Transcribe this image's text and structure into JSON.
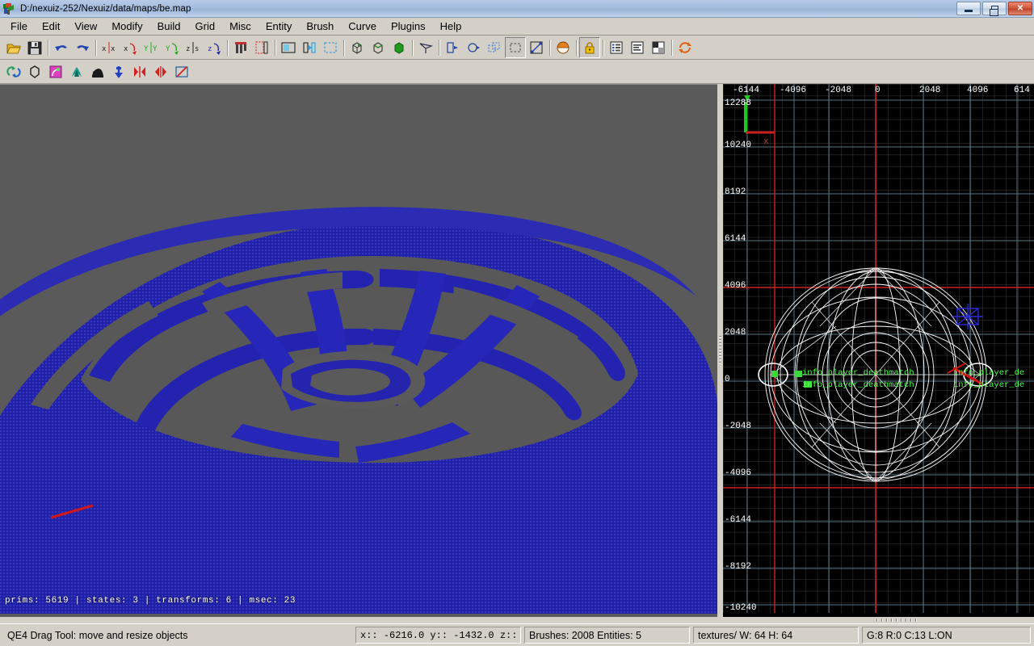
{
  "window": {
    "title": "D:/nexuiz-252/Nexuiz/data/maps/be.map",
    "app_icon": "radiant-app-icon",
    "minimize_label": "",
    "maximize_label": "",
    "close_label": "✕"
  },
  "menubar": {
    "items": [
      {
        "label": "File",
        "accel": "F"
      },
      {
        "label": "Edit",
        "accel": "E"
      },
      {
        "label": "View",
        "accel": "w"
      },
      {
        "label": "Modify",
        "accel": "o"
      },
      {
        "label": "Build",
        "accel": "B"
      },
      {
        "label": "Grid",
        "accel": "G"
      },
      {
        "label": "Misc",
        "accel": "M"
      },
      {
        "label": "Entity",
        "accel": "n"
      },
      {
        "label": "Brush",
        "accel": "r"
      },
      {
        "label": "Curve",
        "accel": "C"
      },
      {
        "label": "Plugins",
        "accel": "P"
      },
      {
        "label": "Help",
        "accel": "H"
      }
    ]
  },
  "toolbar_main": {
    "items": [
      {
        "name": "open-file-button",
        "icon": "folder-open-icon",
        "type": "button"
      },
      {
        "name": "save-file-button",
        "icon": "floppy-save-icon",
        "type": "button"
      },
      {
        "name": "separator-1",
        "icon": "separator",
        "type": "separator"
      },
      {
        "name": "undo-button",
        "icon": "undo-arrow-icon",
        "type": "button"
      },
      {
        "name": "redo-button",
        "icon": "redo-arrow-icon",
        "type": "button"
      },
      {
        "name": "separator-2",
        "icon": "separator",
        "type": "separator"
      },
      {
        "name": "flip-x-button",
        "icon": "flip-x-icon",
        "type": "button"
      },
      {
        "name": "rotate-x-button",
        "icon": "rotate-x-icon",
        "type": "button"
      },
      {
        "name": "flip-y-button",
        "icon": "flip-y-icon",
        "type": "button"
      },
      {
        "name": "rotate-y-button",
        "icon": "rotate-y-icon",
        "type": "button"
      },
      {
        "name": "flip-z-button",
        "icon": "flip-z-icon",
        "type": "button"
      },
      {
        "name": "rotate-z-button",
        "icon": "rotate-z-icon",
        "type": "button"
      },
      {
        "name": "separator-3",
        "icon": "separator",
        "type": "separator"
      },
      {
        "name": "clipper-button",
        "icon": "clipper-icon",
        "type": "button"
      },
      {
        "name": "connect-entities-button",
        "icon": "connect-entities-icon",
        "type": "button"
      },
      {
        "name": "separator-4",
        "icon": "separator",
        "type": "separator"
      },
      {
        "name": "show-entities-button",
        "icon": "show-entities-icon",
        "type": "button"
      },
      {
        "name": "change-view-button",
        "icon": "change-view-icon",
        "type": "button"
      },
      {
        "name": "select-inside-button",
        "icon": "select-inside-icon",
        "type": "button"
      },
      {
        "name": "separator-5",
        "icon": "separator",
        "type": "separator"
      },
      {
        "name": "cubic-clip-button",
        "icon": "cube-wire-icon",
        "type": "button"
      },
      {
        "name": "cube-outline-button",
        "icon": "cube-outline-icon",
        "type": "button"
      },
      {
        "name": "cube-filled-button",
        "icon": "cube-filled-icon",
        "type": "button"
      },
      {
        "name": "separator-6",
        "icon": "separator",
        "type": "separator"
      },
      {
        "name": "camera-button",
        "icon": "camera-frustum-icon",
        "type": "button"
      },
      {
        "name": "separator-7",
        "icon": "separator",
        "type": "separator"
      },
      {
        "name": "select-touching-button",
        "icon": "select-touching-icon",
        "type": "button"
      },
      {
        "name": "select-partial-button",
        "icon": "select-partial-icon",
        "type": "button"
      },
      {
        "name": "select-complete-button",
        "icon": "select-complete-icon",
        "type": "button"
      },
      {
        "name": "selection-dashed-button",
        "icon": "selection-dashed-icon",
        "type": "toggle",
        "active": true
      },
      {
        "name": "scale-diagonal-button",
        "icon": "scale-diagonal-icon",
        "type": "button"
      },
      {
        "name": "separator-8",
        "icon": "separator",
        "type": "separator"
      },
      {
        "name": "patch-sphere-button",
        "icon": "sphere-icon",
        "type": "button"
      },
      {
        "name": "separator-9",
        "icon": "separator",
        "type": "separator"
      },
      {
        "name": "texture-lock-button",
        "icon": "padlock-icon",
        "type": "toggle",
        "active": true
      },
      {
        "name": "separator-10",
        "icon": "separator",
        "type": "separator"
      },
      {
        "name": "entity-inspector-button",
        "icon": "entity-list-icon",
        "type": "button"
      },
      {
        "name": "console-button",
        "icon": "console-text-icon",
        "type": "button"
      },
      {
        "name": "texture-browser-button",
        "icon": "checker-texture-icon",
        "type": "button"
      },
      {
        "name": "separator-11",
        "icon": "separator",
        "type": "separator"
      },
      {
        "name": "refresh-button",
        "icon": "refresh-arrows-icon",
        "type": "button"
      }
    ]
  },
  "toolbar_patch": {
    "items": [
      {
        "name": "patch-bend-button",
        "icon": "bend-arrows-icon"
      },
      {
        "name": "patch-cylinder-button",
        "icon": "cylinder-outline-icon"
      },
      {
        "name": "patch-end-cap-button",
        "icon": "endcap-pink-icon"
      },
      {
        "name": "patch-bevel-button",
        "icon": "bevel-teal-icon"
      },
      {
        "name": "patch-cone-button",
        "icon": "cone-black-icon"
      },
      {
        "name": "patch-insert-button",
        "icon": "insert-arrow-icon"
      },
      {
        "name": "patch-mirror-x-button",
        "icon": "mirror-x-icon"
      },
      {
        "name": "patch-mirror-y-button",
        "icon": "mirror-y-icon"
      },
      {
        "name": "patch-weld-button",
        "icon": "weld-off-icon"
      }
    ]
  },
  "view3d": {
    "name": "camera-view",
    "stats": "prims: 5619 | states: 3 | transforms: 6 | msec: 23",
    "background_color": "#5a5a5a",
    "geometry_color": "#2222aa"
  },
  "view2d": {
    "name": "xy-top-view",
    "background_color": "#000000",
    "grid_minor_color": "#404040",
    "grid_major_color": "#5a7a8a",
    "axis_color": "#cc2222",
    "x_axis_labels": [
      "-6144",
      "-4096",
      "-2048",
      "0",
      "2048",
      "4096",
      "614"
    ],
    "y_axis_labels": [
      "12288",
      "10240",
      "8192",
      "6144",
      "4096",
      "2048",
      "0",
      "-2048",
      "-4096",
      "-6144",
      "-8192",
      "-10240"
    ],
    "entity_labels": [
      "info_player_deathmatch",
      "info_player_deathmatch",
      "info_player_de",
      "info_player_de"
    ],
    "entity_label_color": "#4cff4c"
  },
  "statusbar": {
    "tool": "QE4 Drag Tool: move and resize objects",
    "coords": "x:: -6216.0  y:: -1432.0  z::   ...",
    "brushes": "Brushes: 2008 Entities: 5",
    "texture": "textures/ W: 64 H: 64",
    "grid": "G:8  R:0  C:13  L:ON"
  }
}
